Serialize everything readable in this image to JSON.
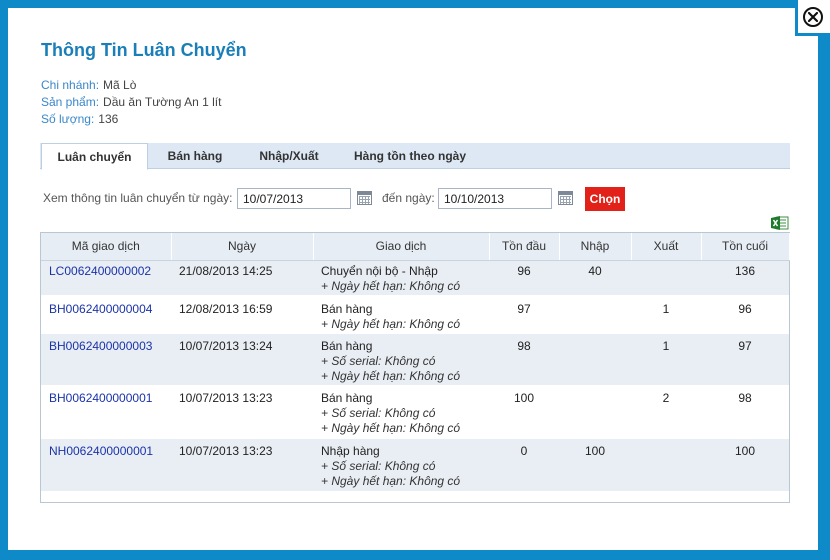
{
  "dialog": {
    "title": "Thông Tin Luân Chuyển",
    "close_icon": "close-icon"
  },
  "info": {
    "branch_label": "Chi nhánh:",
    "branch_value": "Mã Lò",
    "product_label": "Sản phẩm:",
    "product_value": "Dầu ăn Tường An 1 lít",
    "qty_label": "Số lượng:",
    "qty_value": "136"
  },
  "tabs": [
    {
      "label": "Luân chuyển",
      "active": true
    },
    {
      "label": "Bán hàng",
      "active": false
    },
    {
      "label": "Nhập/Xuất",
      "active": false
    },
    {
      "label": "Hàng tồn theo ngày",
      "active": false
    }
  ],
  "filter": {
    "from_label": "Xem thông tin luân chuyển từ ngày:",
    "from_value": "10/07/2013",
    "to_label": "đến ngày:",
    "to_value": "10/10/2013",
    "submit_label": "Chọn",
    "submit_color": "#e22218"
  },
  "table": {
    "headers": [
      "Mã giao dịch",
      "Ngày",
      "Giao dịch",
      "Tồn đầu",
      "Nhập",
      "Xuất",
      "Tồn cuối"
    ],
    "rows": [
      {
        "code": "LC0062400000002",
        "date": "21/08/2013 14:25",
        "tx": "Chuyển nội bộ - Nhập",
        "subs": [
          "+ Ngày hết hạn: Không có"
        ],
        "open": "96",
        "in": "40",
        "out": "",
        "close": "136"
      },
      {
        "code": "BH0062400000004",
        "date": "12/08/2013 16:59",
        "tx": "Bán hàng",
        "subs": [
          "+ Ngày hết hạn: Không có"
        ],
        "open": "97",
        "in": "",
        "out": "1",
        "close": "96"
      },
      {
        "code": "BH0062400000003",
        "date": "10/07/2013 13:24",
        "tx": "Bán hàng",
        "subs": [
          "+ Số serial: Không có",
          "+ Ngày hết hạn: Không có"
        ],
        "open": "98",
        "in": "",
        "out": "1",
        "close": "97"
      },
      {
        "code": "BH0062400000001",
        "date": "10/07/2013 13:23",
        "tx": "Bán hàng",
        "subs": [
          "+ Số serial: Không có",
          "+ Ngày hết hạn: Không có"
        ],
        "open": "100",
        "in": "",
        "out": "2",
        "close": "98"
      },
      {
        "code": "NH0062400000001",
        "date": "10/07/2013 13:23",
        "tx": "Nhập hàng",
        "subs": [
          "+ Số serial: Không có",
          "+ Ngày hết hạn: Không có"
        ],
        "open": "0",
        "in": "100",
        "out": "",
        "close": "100"
      }
    ]
  },
  "icons": {
    "calendar": "calendar-icon",
    "export": "excel-export-icon"
  },
  "colors": {
    "frame": "#0e8ac8",
    "title": "#1a7fb8",
    "label": "#3a87c9",
    "link": "#1a33a8"
  }
}
